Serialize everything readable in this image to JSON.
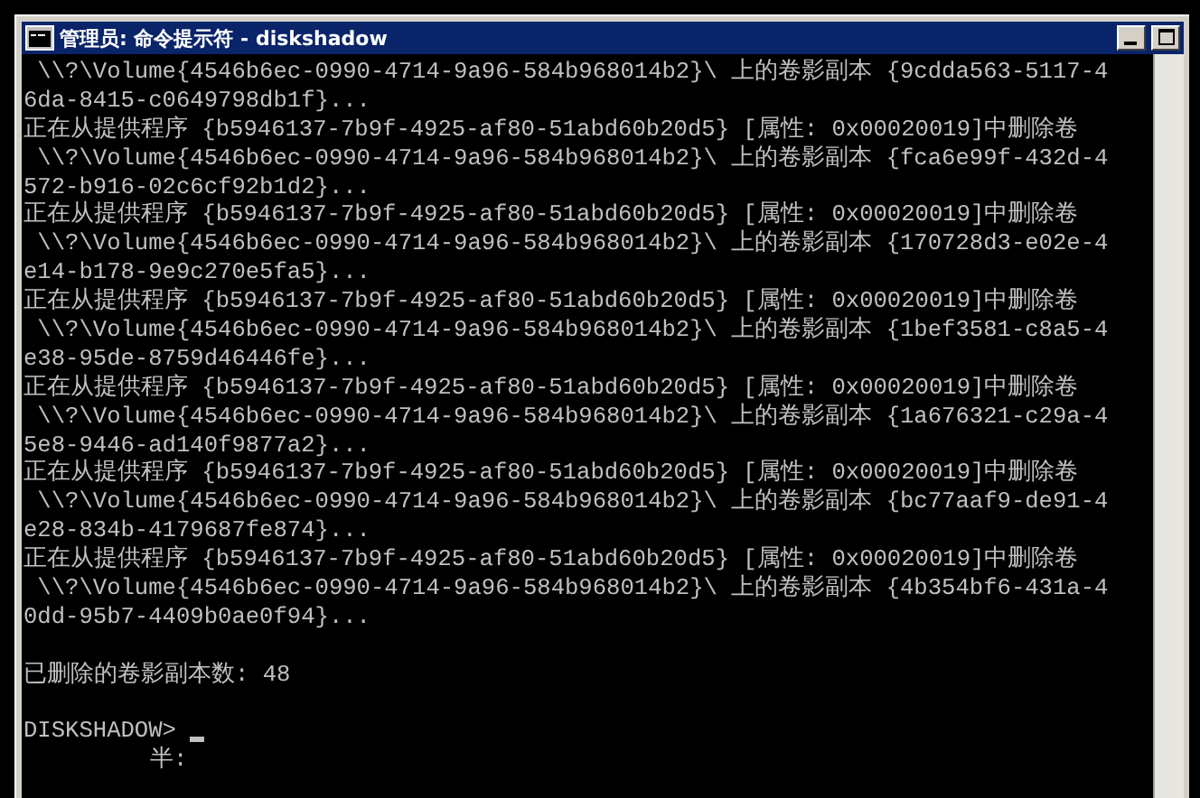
{
  "window": {
    "title": "管理员: 命令提示符 - diskshadow",
    "buttons": [
      {
        "kind": "minimize"
      },
      {
        "kind": "maximize"
      }
    ]
  },
  "console": {
    "lines": [
      {
        "kind": "output",
        "text": " \\\\?\\Volume{4546b6ec-0990-4714-9a96-584b968014b2}\\ 上的卷影副本 {9cdda563-5117-4"
      },
      {
        "kind": "output",
        "text": "6da-8415-c0649798db1f}..."
      },
      {
        "kind": "output",
        "text": "正在从提供程序 {b5946137-7b9f-4925-af80-51abd60b20d5} [属性: 0x00020019]中删除卷"
      },
      {
        "kind": "output",
        "text": " \\\\?\\Volume{4546b6ec-0990-4714-9a96-584b968014b2}\\ 上的卷影副本 {fca6e99f-432d-4"
      },
      {
        "kind": "output",
        "text": "572-b916-02c6cf92b1d2}..."
      },
      {
        "kind": "output",
        "text": "正在从提供程序 {b5946137-7b9f-4925-af80-51abd60b20d5} [属性: 0x00020019]中删除卷"
      },
      {
        "kind": "output",
        "text": " \\\\?\\Volume{4546b6ec-0990-4714-9a96-584b968014b2}\\ 上的卷影副本 {170728d3-e02e-4"
      },
      {
        "kind": "output",
        "text": "e14-b178-9e9c270e5fa5}..."
      },
      {
        "kind": "output",
        "text": "正在从提供程序 {b5946137-7b9f-4925-af80-51abd60b20d5} [属性: 0x00020019]中删除卷"
      },
      {
        "kind": "output",
        "text": " \\\\?\\Volume{4546b6ec-0990-4714-9a96-584b968014b2}\\ 上的卷影副本 {1bef3581-c8a5-4"
      },
      {
        "kind": "output",
        "text": "e38-95de-8759d46446fe}..."
      },
      {
        "kind": "output",
        "text": "正在从提供程序 {b5946137-7b9f-4925-af80-51abd60b20d5} [属性: 0x00020019]中删除卷"
      },
      {
        "kind": "output",
        "text": " \\\\?\\Volume{4546b6ec-0990-4714-9a96-584b968014b2}\\ 上的卷影副本 {1a676321-c29a-4"
      },
      {
        "kind": "output",
        "text": "5e8-9446-ad140f9877a2}..."
      },
      {
        "kind": "output",
        "text": "正在从提供程序 {b5946137-7b9f-4925-af80-51abd60b20d5} [属性: 0x00020019]中删除卷"
      },
      {
        "kind": "output",
        "text": " \\\\?\\Volume{4546b6ec-0990-4714-9a96-584b968014b2}\\ 上的卷影副本 {bc77aaf9-de91-4"
      },
      {
        "kind": "output",
        "text": "e28-834b-4179687fe874}..."
      },
      {
        "kind": "output",
        "text": "正在从提供程序 {b5946137-7b9f-4925-af80-51abd60b20d5} [属性: 0x00020019]中删除卷"
      },
      {
        "kind": "output",
        "text": " \\\\?\\Volume{4546b6ec-0990-4714-9a96-584b968014b2}\\ 上的卷影副本 {4b354bf6-431a-4"
      },
      {
        "kind": "output",
        "text": "0dd-95b7-4409b0ae0f94}..."
      },
      {
        "kind": "blank"
      },
      {
        "kind": "output",
        "text": "已删除的卷影副本数: 48"
      },
      {
        "kind": "blank"
      },
      {
        "kind": "prompt",
        "text": "DISKSHADOW>",
        "cursor": true
      },
      {
        "kind": "ime",
        "text": "半:"
      }
    ]
  }
}
